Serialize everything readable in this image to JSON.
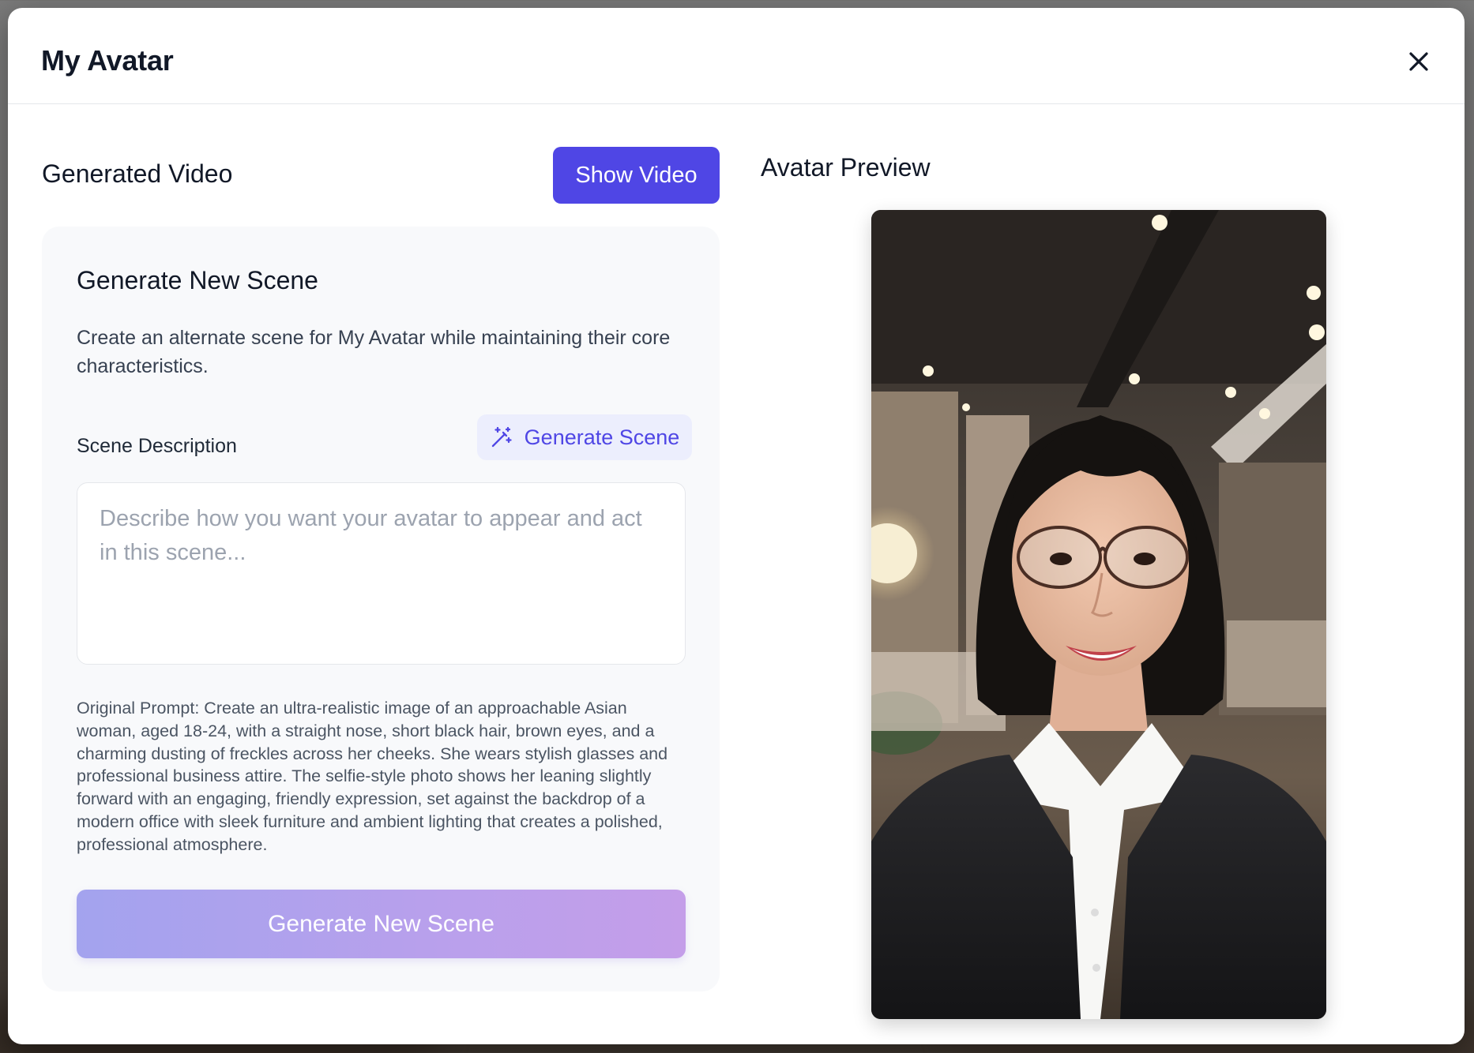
{
  "modal": {
    "title": "My Avatar"
  },
  "generated_video": {
    "title": "Generated Video",
    "show_video_label": "Show Video"
  },
  "scene_card": {
    "title": "Generate New Scene",
    "description": "Create an alternate scene for My Avatar while maintaining their core characteristics.",
    "scene_label": "Scene Description",
    "generate_scene_label": "Generate Scene",
    "textarea_value": "",
    "textarea_placeholder": "Describe how you want your avatar to appear and act in this scene...",
    "original_prompt": "Original Prompt: Create an ultra-realistic image of an approachable Asian woman, aged 18-24, with a straight nose, short black hair, brown eyes, and a charming dusting of freckles across her cheeks. She wears stylish glasses and professional business attire. The selfie-style photo shows her leaning slightly forward with an engaging, friendly expression, set against the backdrop of a modern office with sleek furniture and ambient lighting that creates a polished, professional atmosphere.",
    "generate_new_scene_label": "Generate New Scene"
  },
  "preview": {
    "title": "Avatar Preview"
  },
  "icons": {
    "close": "close-icon",
    "generate_scene": "magic-wand-icon"
  },
  "colors": {
    "primary": "#4f46e5",
    "primary_soft": "#eceefd",
    "gradient_start": "#a3a3ee",
    "gradient_end": "#c49ee9"
  }
}
